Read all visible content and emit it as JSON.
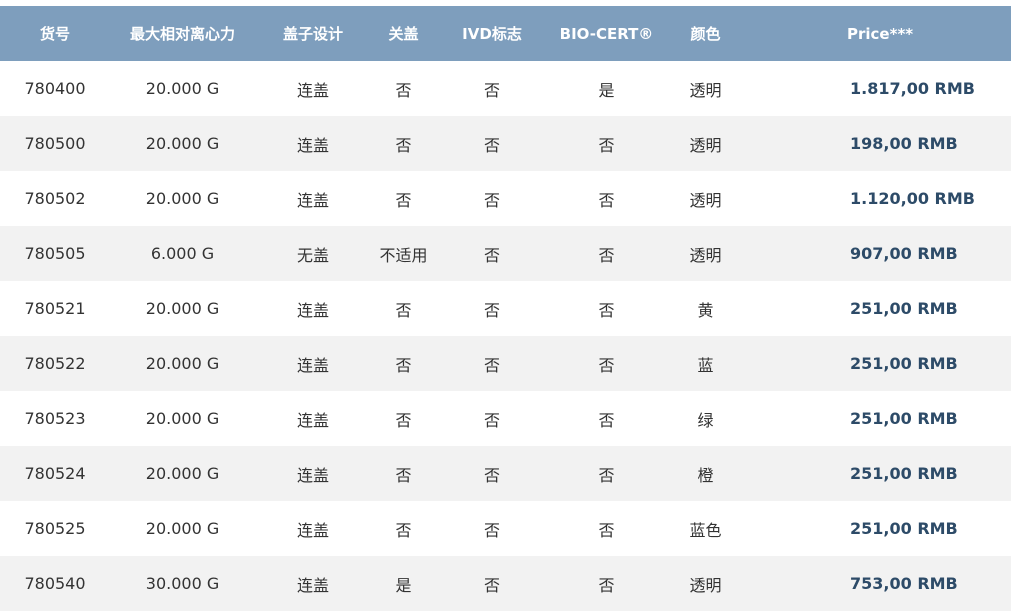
{
  "table": {
    "headers": [
      "货号",
      "最大相对离心力",
      "盖子设计",
      "关盖",
      "IVD标志",
      "BIO-CERT®",
      "颜色",
      "",
      "Price***"
    ],
    "rows": [
      [
        "780400",
        "20.000 G",
        "连盖",
        "否",
        "否",
        "是",
        "透明",
        "1.817,00 RMB"
      ],
      [
        "780500",
        "20.000 G",
        "连盖",
        "否",
        "否",
        "否",
        "透明",
        "198,00 RMB"
      ],
      [
        "780502",
        "20.000 G",
        "连盖",
        "否",
        "否",
        "否",
        "透明",
        "1.120,00 RMB"
      ],
      [
        "780505",
        "6.000 G",
        "无盖",
        "不适用",
        "否",
        "否",
        "透明",
        "907,00 RMB"
      ],
      [
        "780521",
        "20.000 G",
        "连盖",
        "否",
        "否",
        "否",
        "黄",
        "251,00 RMB"
      ],
      [
        "780522",
        "20.000 G",
        "连盖",
        "否",
        "否",
        "否",
        "蓝",
        "251,00 RMB"
      ],
      [
        "780523",
        "20.000 G",
        "连盖",
        "否",
        "否",
        "否",
        "绿",
        "251,00 RMB"
      ],
      [
        "780524",
        "20.000 G",
        "连盖",
        "否",
        "否",
        "否",
        "橙",
        "251,00 RMB"
      ],
      [
        "780525",
        "20.000 G",
        "连盖",
        "否",
        "否",
        "否",
        "蓝色",
        "251,00 RMB"
      ],
      [
        "780540",
        "30.000 G",
        "连盖",
        "是",
        "否",
        "否",
        "透明",
        "753,00 RMB"
      ]
    ]
  },
  "colors": {
    "header_bg": "#7e9ebd",
    "row_alt_bg": "#f2f2f2",
    "price_text": "#2d4b68"
  }
}
